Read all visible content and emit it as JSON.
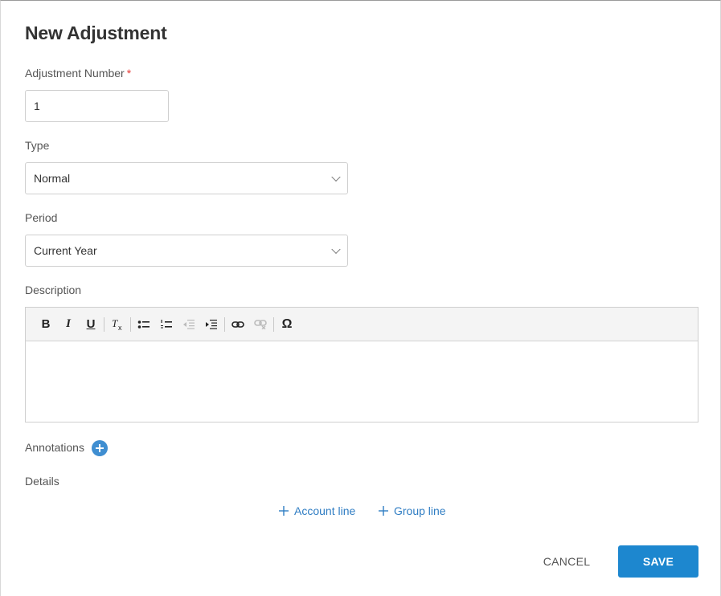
{
  "dialog": {
    "title": "New Adjustment"
  },
  "fields": {
    "adjustment_number": {
      "label": "Adjustment Number",
      "required_mark": "*",
      "value": "1"
    },
    "type": {
      "label": "Type",
      "value": "Normal"
    },
    "period": {
      "label": "Period",
      "value": "Current Year"
    },
    "description": {
      "label": "Description",
      "value": ""
    }
  },
  "toolbar": {
    "bold": "B",
    "italic": "I",
    "underline": "U",
    "remove_format": "Tx",
    "special_char": "Ω"
  },
  "annotations": {
    "label": "Annotations",
    "add_icon": "plus-circle-icon"
  },
  "details": {
    "label": "Details",
    "account_line": "Account line",
    "group_line": "Group line"
  },
  "actions": {
    "cancel": "CANCEL",
    "save": "SAVE"
  },
  "colors": {
    "accent": "#1d87cf",
    "link": "#2f7dc3",
    "required": "#e53935"
  }
}
